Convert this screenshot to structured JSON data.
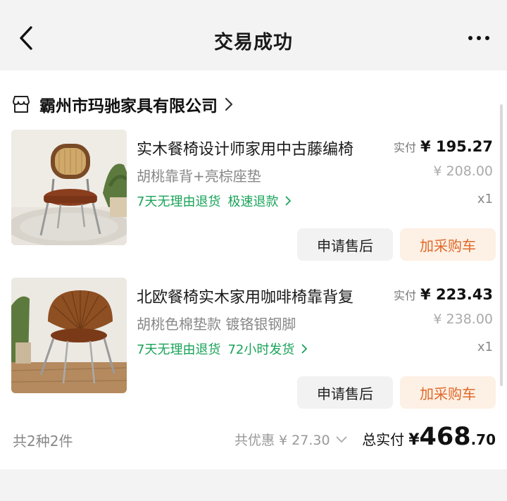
{
  "header": {
    "title": "交易成功",
    "back_icon": "chevron-left-icon",
    "more_icon": "more-dots-icon"
  },
  "shop": {
    "name": "霸州市玛驰家具有限公司",
    "icon": "store-icon"
  },
  "items": [
    {
      "title": "实木餐椅设计师家用中古藤编椅",
      "sku": "胡桃靠背+亮棕座垫",
      "service_return": "7天无理由退货",
      "service_extra": "极速退款",
      "price_label": "实付",
      "price_actual": "¥ 195.27",
      "price_original": "¥ 208.00",
      "quantity": "x1",
      "after_sale_label": "申请售后",
      "add_cart_label": "加采购车"
    },
    {
      "title": "北欧餐椅实木家用咖啡椅靠背复",
      "sku": "胡桃色棉垫款 镀铬银钢脚",
      "service_return": "7天无理由退货",
      "service_extra": "72小时发货",
      "price_label": "实付",
      "price_actual": "¥ 223.43",
      "price_original": "¥ 238.00",
      "quantity": "x1",
      "after_sale_label": "申请售后",
      "add_cart_label": "加采购车"
    }
  ],
  "summary": {
    "count": "共2种2件",
    "discount": "共优惠 ¥ 27.30",
    "total_label": "总实付",
    "total_symbol": "¥",
    "total_integer": "468",
    "total_decimal": ".70"
  },
  "colors": {
    "service_green": "#1aa35a",
    "cart_orange": "#e0692a",
    "cart_bg": "#fdf0e4"
  }
}
